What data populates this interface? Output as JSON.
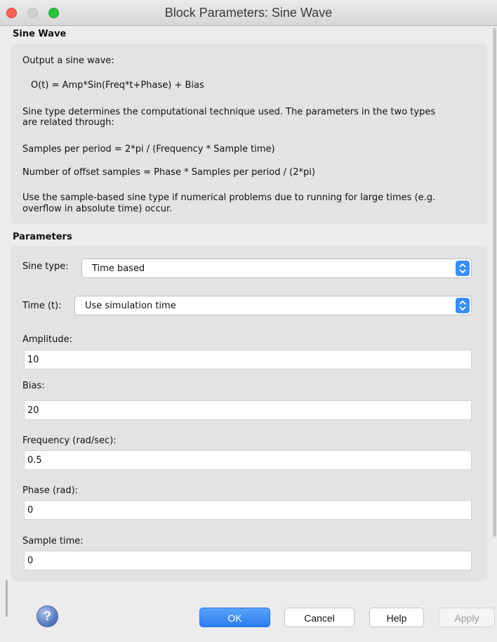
{
  "window": {
    "title": "Block Parameters: Sine Wave"
  },
  "description": {
    "section_title": "Sine Wave",
    "lines": [
      "Output a sine wave:",
      "O(t) = Amp*Sin(Freq*t+Phase) + Bias",
      "Sine type determines the computational technique used. The parameters in the two types",
      "are related through:",
      "Samples per period = 2*pi / (Frequency * Sample time)",
      "Number of offset samples = Phase * Samples per period / (2*pi)",
      "Use the sample-based sine type if numerical problems due to running for large times (e.g.",
      "overflow in absolute time) occur."
    ]
  },
  "parameters": {
    "section_title": "Parameters",
    "sine_type": {
      "label": "Sine type:",
      "value": "Time based"
    },
    "time": {
      "label": "Time (t):",
      "value": "Use simulation time"
    },
    "amplitude": {
      "label": "Amplitude:",
      "value": "10"
    },
    "bias": {
      "label": "Bias:",
      "value": "20"
    },
    "frequency": {
      "label": "Frequency (rad/sec):",
      "value": "0.5"
    },
    "phase": {
      "label": "Phase (rad):",
      "value": "0"
    },
    "sample_time": {
      "label": "Sample time:",
      "value": "0"
    }
  },
  "buttons": {
    "help_icon": "?",
    "ok": "OK",
    "cancel": "Cancel",
    "help": "Help",
    "apply": "Apply"
  },
  "colors": {
    "accent": "#3a8ef6",
    "close": "#fc5f57",
    "maximize": "#29c13f"
  },
  "icons": {
    "help": "question-mark-circle-icon",
    "dropdown": "up-down-chevron-icon"
  }
}
